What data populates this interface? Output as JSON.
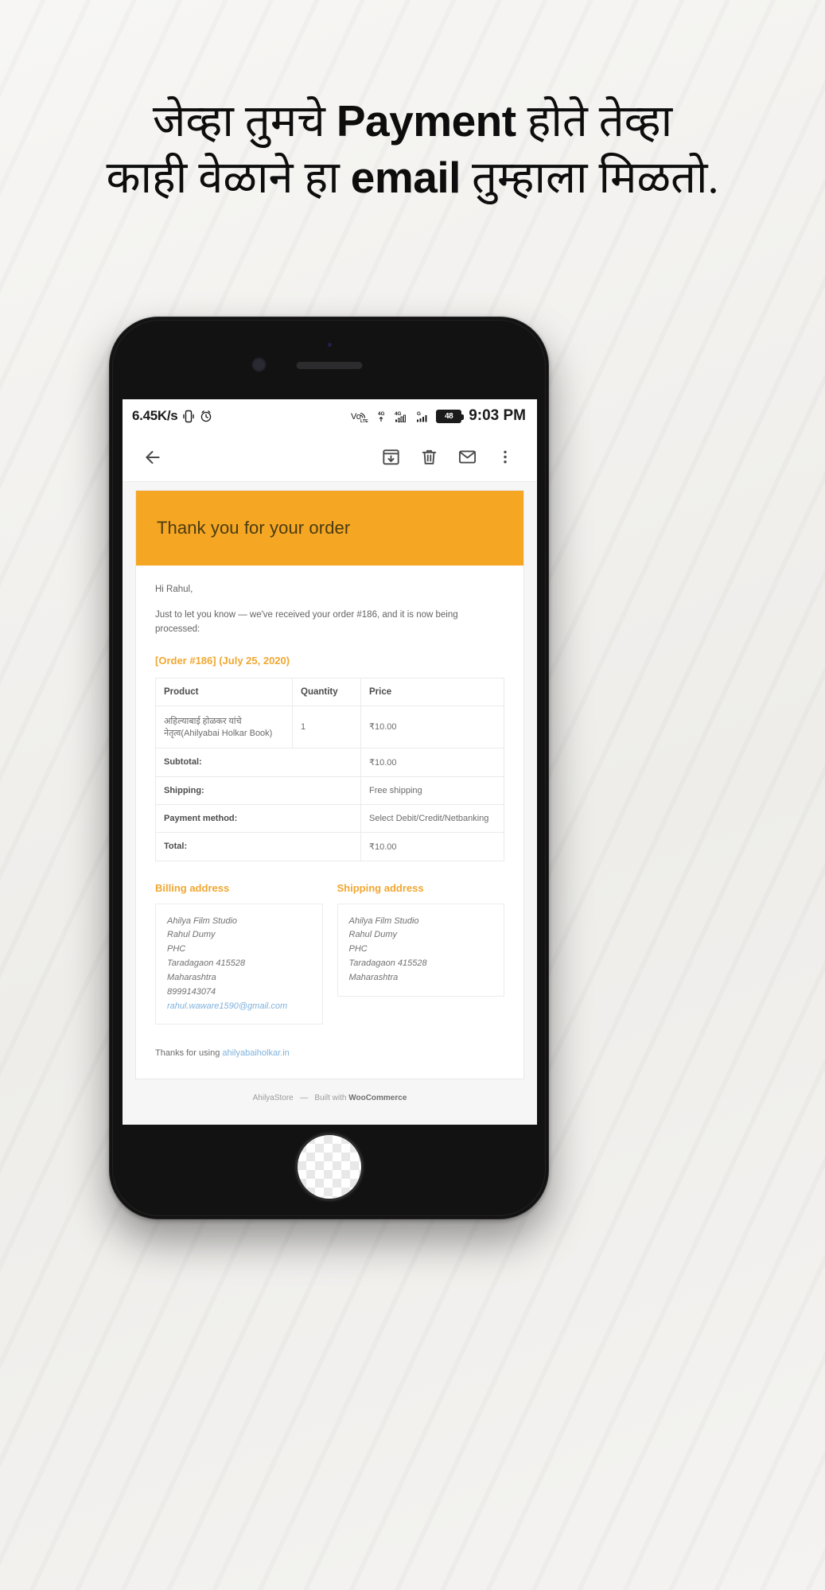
{
  "promo": {
    "line1_part1": "जेव्हा तुमचे ",
    "line1_highlight": "Payment",
    "line1_part2": " होते तेव्हा",
    "line2_part1": "काही वेळाने हा ",
    "line2_highlight": "email",
    "line2_part2": " तुम्हाला मिळतो."
  },
  "statusbar": {
    "network_speed": "6.45K/s",
    "vibrate_icon": "vibrate-icon",
    "alarm_icon": "alarm-clock-icon",
    "volte_icon": "volte-icon",
    "volte_label": "VoLTE",
    "sim1_label": "4G",
    "sim2_label": "4G",
    "sim3_label": "G",
    "battery_percent": "48",
    "time": "9:03 PM"
  },
  "toolbar": {
    "back_icon": "back-arrow-icon",
    "archive_icon": "archive-icon",
    "delete_icon": "trash-icon",
    "unread_icon": "envelope-icon",
    "more_icon": "more-vertical-icon"
  },
  "email": {
    "header_title": "Thank you for your order",
    "header_bg": "#f5a623",
    "accent": "#f0a731",
    "link_color": "#7fb2dd",
    "greeting": "Hi Rahul,",
    "intro": "Just to let you know — we've received your order #186, and it is now being processed:",
    "order_heading": "[Order #186] (July 25, 2020)",
    "table": {
      "headers": [
        "Product",
        "Quantity",
        "Price"
      ],
      "product_devanagari": "अहिल्याबाई होळकर यांचे",
      "product_name": "नेतृत्व(Ahilyabai Holkar Book)",
      "quantity": "1",
      "price": "₹10.00",
      "summary": [
        {
          "label": "Subtotal:",
          "value": "₹10.00"
        },
        {
          "label": "Shipping:",
          "value": "Free shipping"
        },
        {
          "label": "Payment method:",
          "value": "Select Debit/Credit/Netbanking"
        },
        {
          "label": "Total:",
          "value": "₹10.00"
        }
      ]
    },
    "billing": {
      "title": "Billing address",
      "line1": "Ahilya Film Studio",
      "line2": "Rahul Dumy",
      "line3": "PHC",
      "line4": "Taradagaon 415528",
      "line5": "Maharashtra",
      "phone": "8999143074",
      "email": "rahul.waware1590@gmail.com"
    },
    "shipping": {
      "title": "Shipping address",
      "line1": "Ahilya Film Studio",
      "line2": "Rahul Dumy",
      "line3": "PHC",
      "line4": "Taradagaon 415528",
      "line5": "Maharashtra"
    },
    "thanks_prefix": "Thanks for using ",
    "thanks_link": "ahilyabaiholkar.in",
    "footer_store": "AhilyaStore",
    "footer_builtwith": "Built with ",
    "footer_platform": "WooCommerce"
  }
}
